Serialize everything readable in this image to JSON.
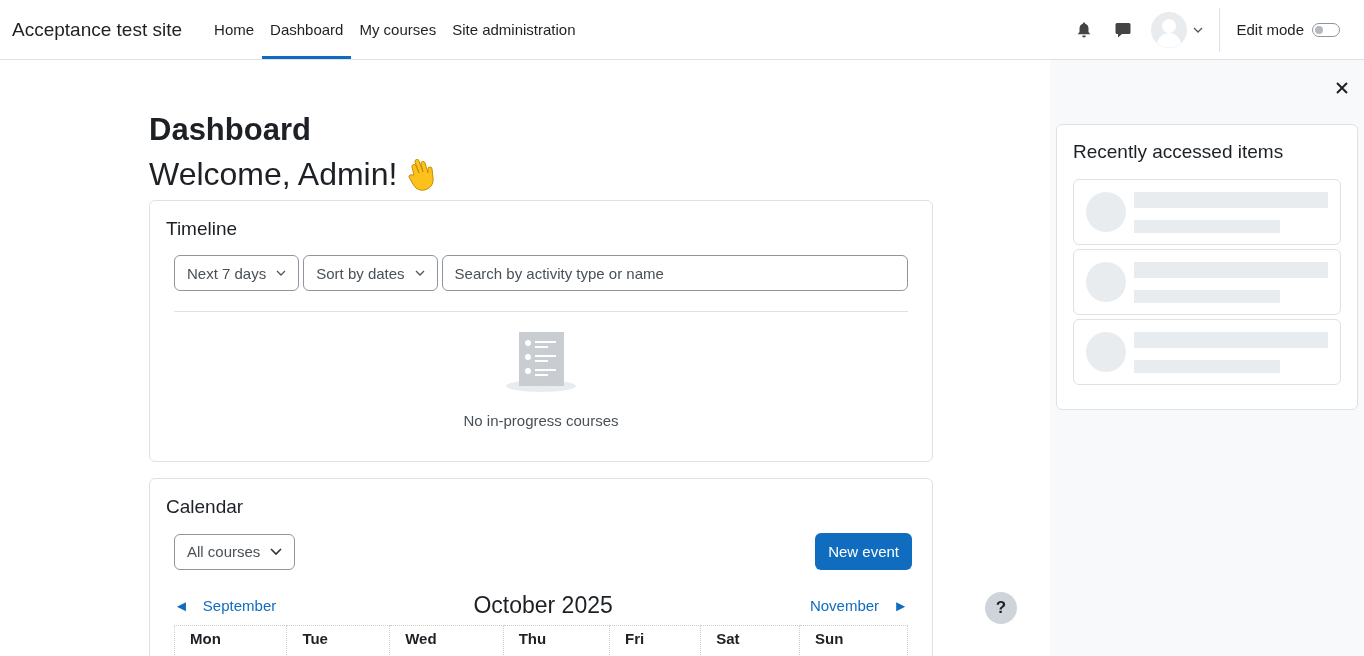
{
  "navbar": {
    "site_name": "Acceptance test site",
    "nav": [
      {
        "label": "Home",
        "selected": false
      },
      {
        "label": "Dashboard",
        "selected": true
      },
      {
        "label": "My courses",
        "selected": false
      },
      {
        "label": "Site administration",
        "selected": false
      }
    ],
    "edit_mode": {
      "label": "Edit mode",
      "on": false
    }
  },
  "page": {
    "title": "Dashboard",
    "welcome": "Welcome, Admin!"
  },
  "timeline": {
    "title": "Timeline",
    "filters": [
      "Next 7 days",
      "Sort by dates"
    ],
    "search": {
      "placeholder": "Search by activity type or name"
    },
    "empty_message": "No in-progress courses"
  },
  "calendar": {
    "title": "Calendar",
    "course_filter": "All courses",
    "new_event": "New event",
    "prev_arrow": "◄",
    "prev": "September",
    "month": "October 2025",
    "next": "November",
    "next_arrow": "►",
    "weekdays": [
      "Mon",
      "Tue",
      "Wed",
      "Thu",
      "Fri",
      "Sat",
      "Sun"
    ]
  },
  "drawer": {
    "title": "Recently accessed items",
    "items": [
      {
        "kind": "placeholder"
      },
      {
        "kind": "placeholder"
      },
      {
        "kind": "placeholder"
      }
    ]
  },
  "help": "?"
}
